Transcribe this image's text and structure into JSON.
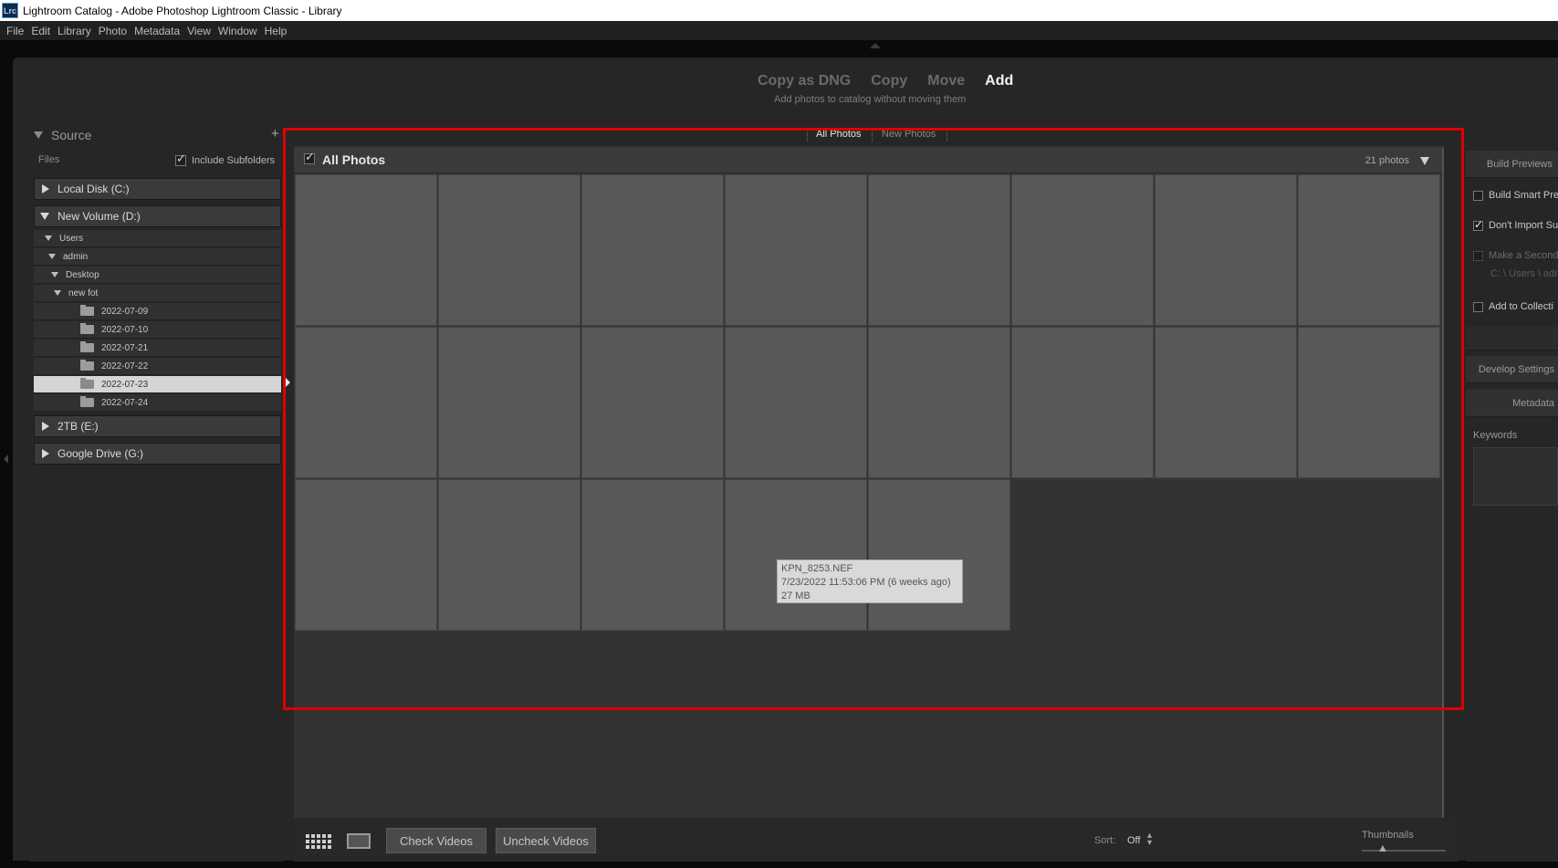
{
  "window": {
    "app_icon": "Lrc",
    "title": "Lightroom Catalog - Adobe Photoshop Lightroom Classic - Library"
  },
  "menu": [
    "File",
    "Edit",
    "Library",
    "Photo",
    "Metadata",
    "View",
    "Window",
    "Help"
  ],
  "import_modes": {
    "items": [
      "Copy as DNG",
      "Copy",
      "Move",
      "Add"
    ],
    "active": "Add",
    "subtitle": "Add photos to catalog without moving them"
  },
  "source_panel": {
    "header": "Source",
    "add_icon": "+",
    "files_label": "Files",
    "include_subfolders": {
      "label": "Include Subfolders",
      "checked": true
    },
    "drives": [
      {
        "label": "Local Disk (C:)",
        "expanded": false
      },
      {
        "label": "New Volume (D:)",
        "expanded": true
      },
      {
        "label": "2TB (E:)",
        "expanded": false
      },
      {
        "label": "Google Drive (G:)",
        "expanded": false
      }
    ],
    "tree": [
      {
        "label": "Users",
        "type": "expanded"
      },
      {
        "label": "admin",
        "type": "expanded"
      },
      {
        "label": "Desktop",
        "type": "expanded"
      },
      {
        "label": "new fot",
        "type": "expanded"
      },
      {
        "label": "2022-07-09",
        "type": "folder"
      },
      {
        "label": "2022-07-10",
        "type": "folder"
      },
      {
        "label": "2022-07-21",
        "type": "folder"
      },
      {
        "label": "2022-07-22",
        "type": "folder"
      },
      {
        "label": "2022-07-23",
        "type": "folder",
        "selected": true
      },
      {
        "label": "2022-07-24",
        "type": "folder"
      }
    ]
  },
  "filter_tabs": {
    "all": "All Photos",
    "new": "New Photos",
    "active": "All Photos"
  },
  "grid": {
    "title": "All Photos",
    "checked": true,
    "count": "21 photos",
    "thumbnail_count": 21
  },
  "tooltip": {
    "filename": "KPN_8253.NEF",
    "date": "7/23/2022 11:53:06 PM (6 weeks ago)",
    "size": "27 MB"
  },
  "toolbar": {
    "check_videos": "Check Videos",
    "uncheck_videos": "Uncheck Videos",
    "sort_label": "Sort:",
    "sort_value": "Off",
    "thumbnails_label": "Thumbnails",
    "thumbnail_size": 0.25
  },
  "right_panel": {
    "build_previews": "Build Previews",
    "build_smart_previews": {
      "label": "Build Smart Pre",
      "checked": false
    },
    "dont_import_suspected": {
      "label": "Don't Import Su",
      "checked": true
    },
    "make_second_copy": {
      "label": "Make a Second",
      "checked": false,
      "path": "C: \\ Users \\ adr"
    },
    "add_to_collection": {
      "label": "Add to Collecti",
      "checked": false
    },
    "develop_settings": "Develop Settings",
    "metadata": "Metadata",
    "keywords": "Keywords"
  },
  "colors": {
    "highlight_box": "#e00000",
    "thumbnail": "#585858",
    "panel": "#262626"
  }
}
